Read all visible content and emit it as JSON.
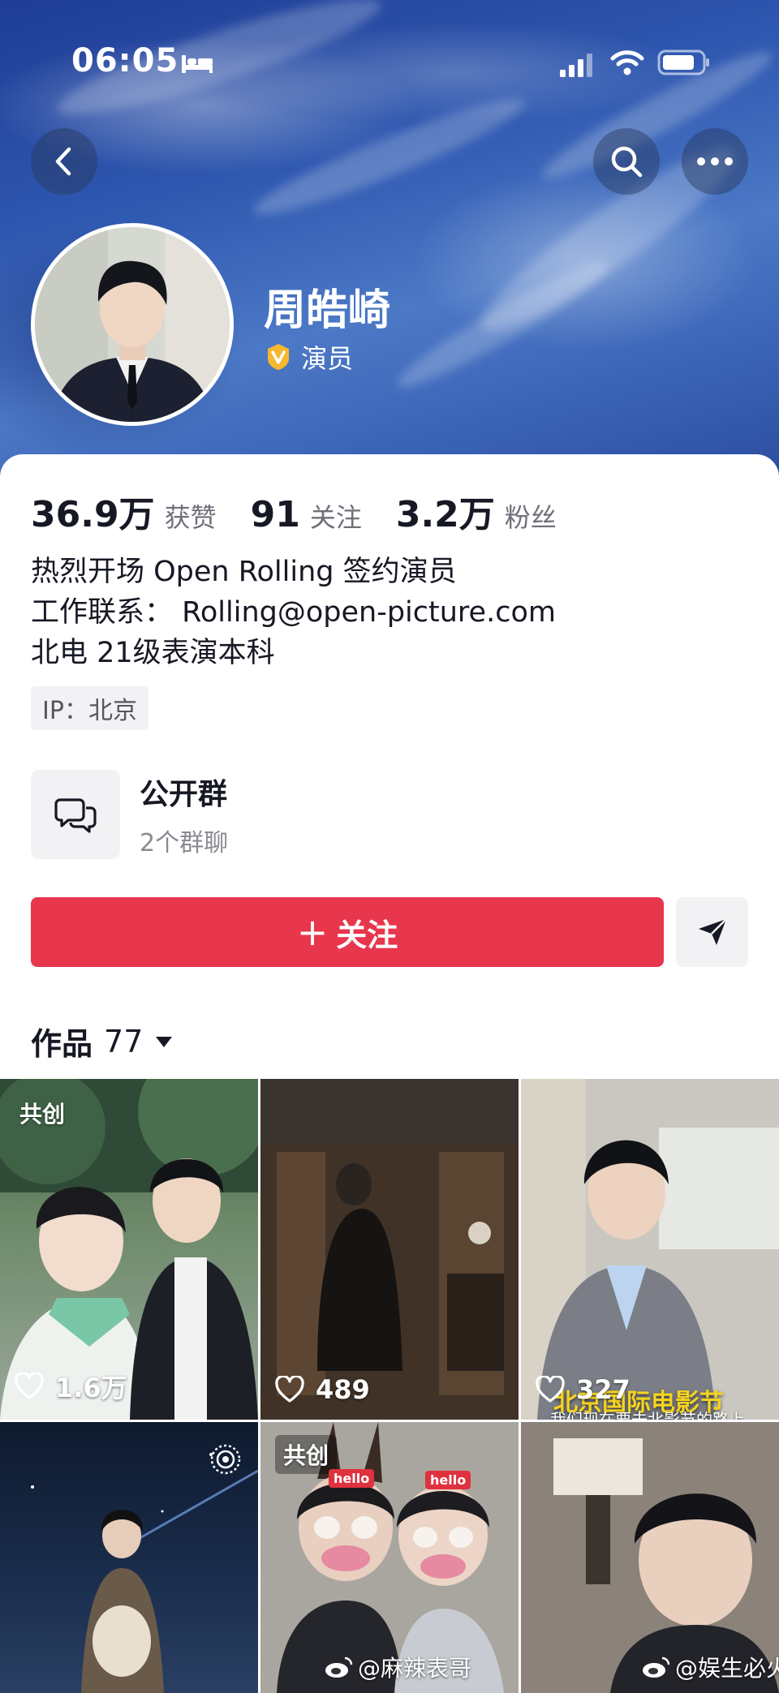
{
  "status_bar": {
    "time": "06:05"
  },
  "profile": {
    "name": "周皓崎",
    "verified_label": "演员",
    "stats": [
      {
        "value": "36.9万",
        "label": "获赞"
      },
      {
        "value": "91",
        "label": "关注"
      },
      {
        "value": "3.2万",
        "label": "粉丝"
      }
    ],
    "bio": [
      "热烈开场 Open Rolling 签约演员",
      "工作联系： Rolling@open-picture.com",
      "北电 21级表演本科"
    ],
    "ip_tag": "IP：北京"
  },
  "group": {
    "title": "公开群",
    "subtitle": "2个群聊"
  },
  "actions": {
    "follow_label": "关注",
    "follow_prefix": "+"
  },
  "works": {
    "label": "作品",
    "count": "77"
  },
  "grid": {
    "tiles": [
      {
        "badge": "共创",
        "likes": "1.6万"
      },
      {
        "badge": "",
        "likes": "489"
      },
      {
        "badge": "",
        "likes": "327",
        "overlay_title": "北京国际电影节",
        "overlay_sub": "我们现在要去北影节的路上"
      },
      {
        "badge": "",
        "likes": ""
      },
      {
        "badge": "共创",
        "likes": "",
        "stickers": [
          "hello",
          "hello"
        ]
      },
      {
        "badge": "",
        "likes": ""
      }
    ]
  },
  "watermarks": [
    "@麻辣表哥",
    "@娱生必火"
  ],
  "colors": {
    "accent": "#e8364d",
    "banner": "#2f58b0",
    "verified": "#f5b82e"
  }
}
